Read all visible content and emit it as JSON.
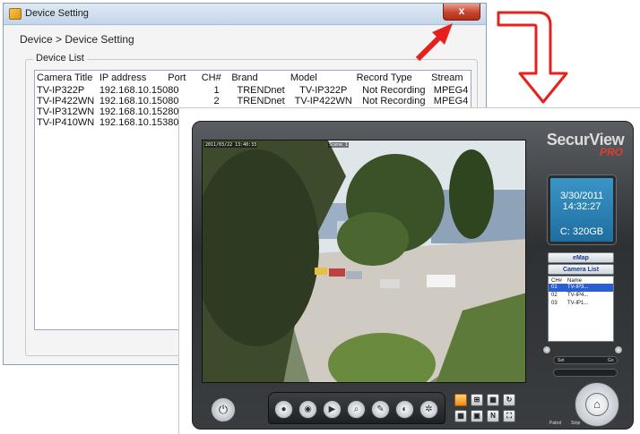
{
  "device_window": {
    "title": "Device Setting",
    "close_label": "x",
    "breadcrumb": "Device > Device Setting",
    "group_label": "Device List",
    "columns": [
      "Camera Title",
      "IP address",
      "Port",
      "CH#",
      "Brand",
      "Model",
      "Record Type",
      "Stream"
    ],
    "rows": [
      [
        "TV-IP322P",
        "192.168.10.150",
        "80",
        "1",
        "TRENDnet",
        "TV-IP322P",
        "Not Recording",
        "MPEG4"
      ],
      [
        "TV-IP422WN",
        "192.168.10.150",
        "80",
        "2",
        "TRENDnet",
        "TV-IP422WN",
        "Not Recording",
        "MPEG4"
      ],
      [
        "TV-IP312WN",
        "192.168.10.152",
        "80",
        "",
        "",
        "",
        "",
        ""
      ],
      [
        "TV-IP410WN",
        "192.168.10.153",
        "80",
        "",
        "",
        "",
        "",
        ""
      ]
    ]
  },
  "arrow_color": "#e8201c",
  "securview": {
    "brand": "SecurView",
    "brand_sub": "PRO",
    "video": {
      "osd_time": "2011/03/22 13:40:33",
      "osd_cam": "Scene 1"
    },
    "clock": {
      "date": "3/30/2011",
      "time": "14:32:27",
      "disk": "C: 320GB"
    },
    "emap_label": "eMap",
    "camera_list_label": "Camera List",
    "camera_list": {
      "headers": [
        "CH#",
        "Name"
      ],
      "rows": [
        {
          "ch": "01",
          "name": "TV-IP3...",
          "selected": true
        },
        {
          "ch": "02",
          "name": "TV-IP4...",
          "selected": false
        },
        {
          "ch": "03",
          "name": "TV-IP1...",
          "selected": false
        }
      ]
    },
    "ptz": {
      "set_label": "Set",
      "go_label": "Go",
      "patrol_label": "Patrol",
      "stop_label": "Stop"
    },
    "toolbar_icons": [
      "record-icon",
      "snapshot-icon",
      "play-icon",
      "search-icon",
      "edit-icon",
      "audio-icon",
      "settings-icon"
    ],
    "layout_buttons": [
      "1x1",
      "2x2",
      "3x3",
      "rotate",
      "4x4",
      "seq",
      "N",
      "full"
    ]
  }
}
